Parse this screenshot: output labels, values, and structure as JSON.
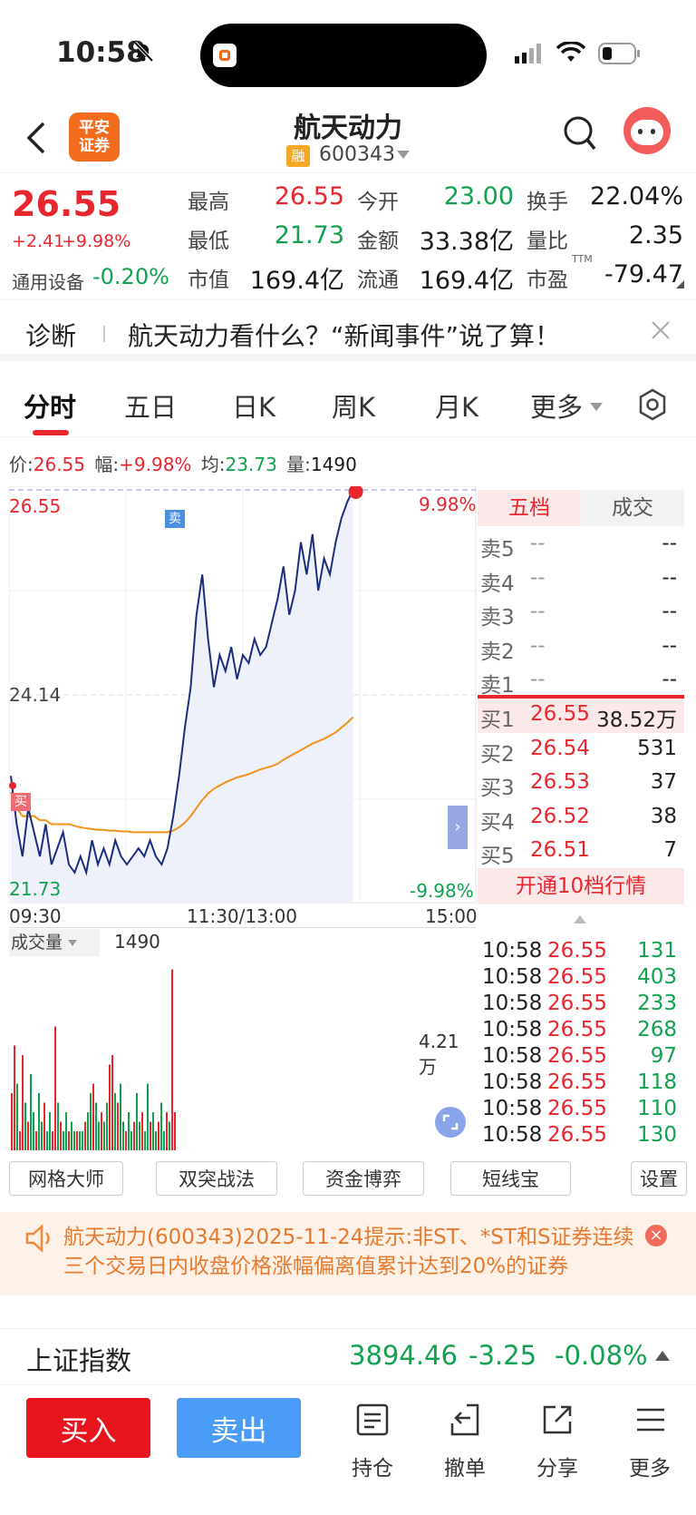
{
  "status": {
    "time": "10:58"
  },
  "header": {
    "title": "航天动力",
    "code": "600343",
    "margin_badge": "融",
    "broker_logo": "平安\n证券"
  },
  "quote": {
    "price": "26.55",
    "change": "+2.41",
    "change_pct": "+9.98%",
    "sector_label": "通用设备",
    "sector_change": "-0.20%",
    "items": [
      {
        "label": "最高",
        "value": "26.55"
      },
      {
        "label": "今开",
        "value": "23.00"
      },
      {
        "label": "换手",
        "value": "22.04%"
      },
      {
        "label": "最低",
        "value": "21.73"
      },
      {
        "label": "金额",
        "value": "33.38亿"
      },
      {
        "label": "量比",
        "value": "2.35"
      },
      {
        "label": "市值",
        "value": "169.4亿"
      },
      {
        "label": "流通",
        "value": "169.4亿"
      },
      {
        "label": "市盈",
        "value": "-79.47",
        "sup": "TTM"
      }
    ]
  },
  "banner": {
    "tag": "诊断",
    "text": "航天动力看什么？“新闻事件”说了算！"
  },
  "tabs": [
    "分时",
    "五日",
    "日K",
    "周K",
    "月K",
    "更多"
  ],
  "metrics": {
    "price_label": "价:",
    "price": "26.55",
    "amp_label": "幅:",
    "amp": "+9.98%",
    "avg_label": "均:",
    "avg": "23.73",
    "vol_label": "量:",
    "vol": "1490"
  },
  "chart_data": {
    "type": "line",
    "y_high": "26.55",
    "y_mid": "24.14",
    "y_low": "21.73",
    "pct_high": "9.98%",
    "pct_low": "-9.98%",
    "x_labels": [
      "09:30",
      "11:30/13:00",
      "15:00"
    ],
    "ylim": [
      21.73,
      26.55
    ],
    "series": [
      {
        "color": "#1c2d80",
        "values": [
          23.0,
          22.4,
          22.0,
          22.6,
          22.3,
          22.0,
          22.4,
          21.9,
          22.1,
          22.3,
          21.9,
          21.8,
          22.0,
          21.8,
          22.2,
          21.9,
          22.1,
          21.9,
          22.2,
          22.0,
          21.9,
          22.0,
          22.1,
          22.0,
          22.2,
          22.0,
          21.9,
          22.1,
          22.5,
          23.0,
          23.6,
          24.1,
          25.0,
          25.5,
          24.7,
          24.1,
          24.5,
          24.3,
          24.6,
          24.2,
          24.5,
          24.4,
          24.7,
          24.5,
          24.6,
          24.9,
          25.2,
          25.6,
          25.0,
          25.3,
          25.9,
          25.5,
          26.0,
          25.3,
          25.7,
          25.5,
          25.9,
          26.2,
          26.4,
          26.55
        ]
      },
      {
        "color": "#f0921c",
        "values": [
          22.8,
          22.6,
          22.5,
          22.5,
          22.5,
          22.45,
          22.45,
          22.4,
          22.4,
          22.4,
          22.4,
          22.38,
          22.36,
          22.35,
          22.34,
          22.33,
          22.33,
          22.32,
          22.32,
          22.31,
          22.31,
          22.3,
          22.3,
          22.3,
          22.3,
          22.3,
          22.3,
          22.3,
          22.32,
          22.36,
          22.42,
          22.5,
          22.6,
          22.7,
          22.78,
          22.84,
          22.88,
          22.92,
          22.95,
          22.98,
          23.0,
          23.02,
          23.05,
          23.08,
          23.1,
          23.12,
          23.15,
          23.2,
          23.24,
          23.28,
          23.32,
          23.36,
          23.4,
          23.43,
          23.46,
          23.5,
          23.54,
          23.6,
          23.66,
          23.73
        ]
      }
    ],
    "markers": {
      "buy": "买",
      "sell": "卖"
    }
  },
  "volume": {
    "label": "成交量",
    "value": "1490",
    "axis": "4.21万",
    "bars": [
      0.3,
      0.55,
      0.35,
      0.1,
      0.5,
      0.25,
      0.15,
      0.4,
      0.2,
      0.1,
      0.3,
      0.15,
      0.25,
      0.1,
      0.2,
      0.1,
      0.65,
      0.25,
      0.15,
      0.1,
      0.2,
      0.1,
      0.15,
      0.1,
      0.1,
      0.1,
      0.1,
      0.15,
      0.2,
      0.3,
      0.35,
      0.25,
      0.15,
      0.2,
      0.15,
      0.25,
      0.45,
      0.5,
      0.3,
      0.25,
      0.35,
      0.15,
      0.1,
      0.2,
      0.1,
      0.15,
      0.3,
      0.15,
      0.2,
      0.1,
      0.35,
      0.15,
      0.2,
      0.1,
      0.15,
      0.25,
      0.1,
      0.2,
      0.15,
      0.95,
      0.2
    ]
  },
  "orderbook": {
    "tabs": [
      "五档",
      "成交"
    ],
    "asks": [
      {
        "label": "卖5",
        "price": "--",
        "vol": "--"
      },
      {
        "label": "卖4",
        "price": "--",
        "vol": "--"
      },
      {
        "label": "卖3",
        "price": "--",
        "vol": "--"
      },
      {
        "label": "卖2",
        "price": "--",
        "vol": "--"
      },
      {
        "label": "卖1",
        "price": "--",
        "vol": "--"
      }
    ],
    "bids": [
      {
        "label": "买1",
        "price": "26.55",
        "vol": "38.52万"
      },
      {
        "label": "买2",
        "price": "26.54",
        "vol": "531"
      },
      {
        "label": "买3",
        "price": "26.53",
        "vol": "37"
      },
      {
        "label": "买4",
        "price": "26.52",
        "vol": "38"
      },
      {
        "label": "买5",
        "price": "26.51",
        "vol": "7"
      }
    ],
    "upgrade": "开通10档行情"
  },
  "ticks": [
    {
      "t": "10:58",
      "p": "26.55",
      "v": "131"
    },
    {
      "t": "10:58",
      "p": "26.55",
      "v": "403"
    },
    {
      "t": "10:58",
      "p": "26.55",
      "v": "233"
    },
    {
      "t": "10:58",
      "p": "26.55",
      "v": "268"
    },
    {
      "t": "10:58",
      "p": "26.55",
      "v": "97"
    },
    {
      "t": "10:58",
      "p": "26.55",
      "v": "118"
    },
    {
      "t": "10:58",
      "p": "26.55",
      "v": "110"
    },
    {
      "t": "10:58",
      "p": "26.55",
      "v": "130"
    }
  ],
  "tools": [
    "网格大师",
    "双突战法",
    "资金博弈",
    "短线宝",
    "设置"
  ],
  "notice": {
    "text": "航天动力(600343)2025-11-24提示:非ST、*ST和S证券连续三个交易日内收盘价格涨幅偏离值累计达到20%的证券"
  },
  "index": {
    "name": "上证指数",
    "value": "3894.46",
    "change": "-3.25",
    "pct": "-0.08%"
  },
  "bottom": {
    "buy": "买入",
    "sell": "卖出",
    "icons": [
      "持仓",
      "撤单",
      "分享",
      "更多"
    ]
  },
  "colors": {
    "up": "#e8262e",
    "down": "#11a14f",
    "price_line": "#1c2d80",
    "avg_line": "#f0921c",
    "buy_btn": "#e8151f",
    "sell_btn": "#4b9cf6"
  }
}
